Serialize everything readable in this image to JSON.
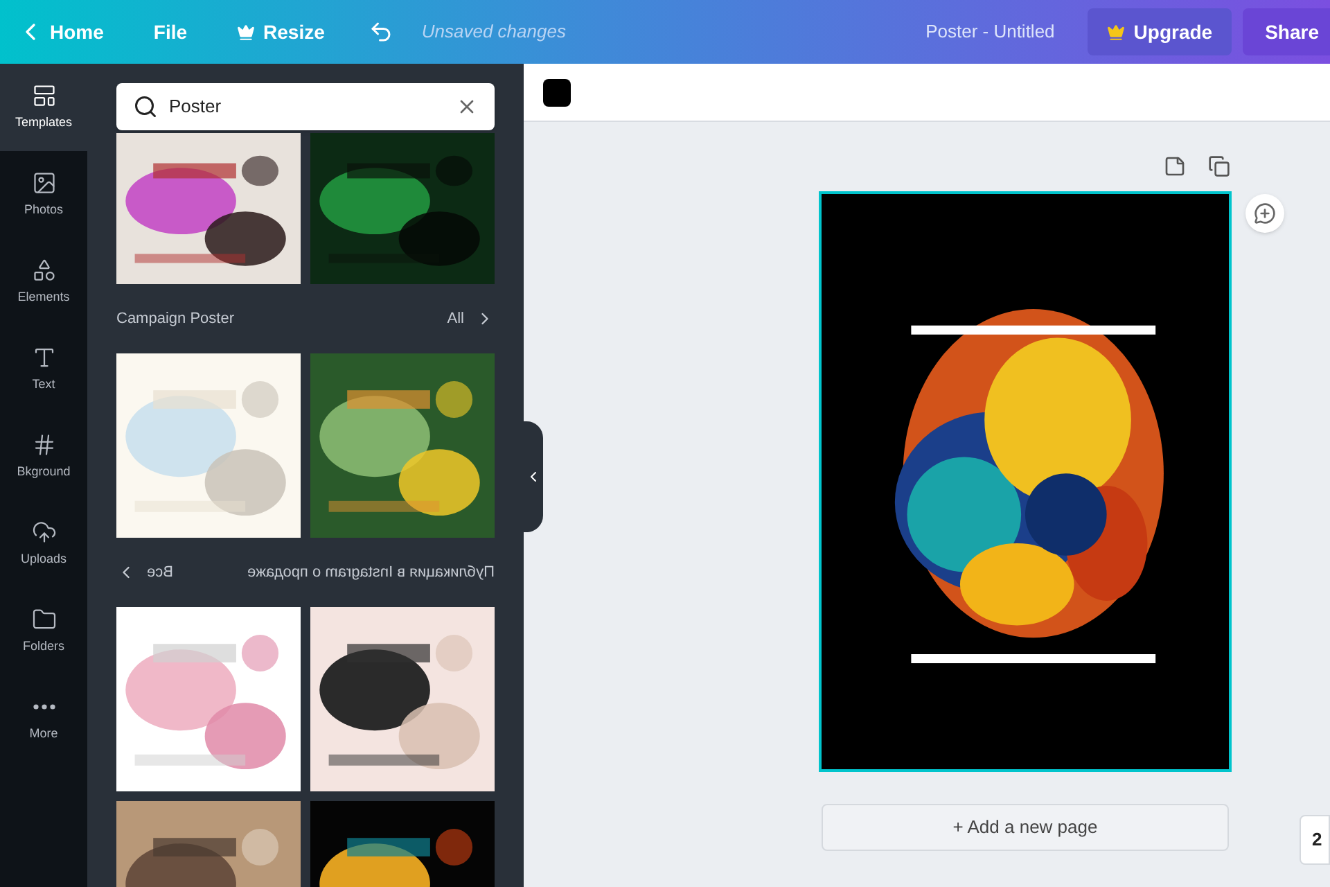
{
  "topbar": {
    "back": "Home",
    "menu": [
      "File",
      "Resize"
    ],
    "status": "Unsaved changes",
    "title": "Poster - Untitled",
    "upgrade": "Upgrade",
    "share": "Share"
  },
  "rail": [
    {
      "label": "Templates",
      "kind": "templates",
      "selected": true
    },
    {
      "label": "Photos",
      "kind": "photos",
      "selected": false
    },
    {
      "label": "Elements",
      "kind": "elements",
      "selected": false
    },
    {
      "label": "Text",
      "kind": "text",
      "selected": false
    },
    {
      "label": "Bkground",
      "kind": "background",
      "selected": false
    },
    {
      "label": "Uploads",
      "kind": "uploads",
      "selected": false
    },
    {
      "label": "Folders",
      "kind": "folders",
      "selected": false
    },
    {
      "label": "More",
      "kind": "more",
      "selected": false
    }
  ],
  "search": {
    "value": "Poster"
  },
  "sections": [
    {
      "thumbs": [
        {
          "kind": "picture"
        },
        {
          "kind": "picture"
        }
      ]
    },
    {
      "title": "Campaign Poster",
      "link": "All",
      "mirrored": false,
      "thumbs": [
        {
          "kind": "picture"
        },
        {
          "kind": "picture"
        }
      ]
    },
    {
      "title": "Публикация в Instagram о продаже",
      "link": "Все",
      "mirrored": true,
      "thumbs": [
        {
          "kind": "picture"
        },
        {
          "kind": "picture"
        }
      ]
    },
    {
      "thumbs": [
        {
          "kind": "picture"
        },
        {
          "kind": "picture"
        }
      ]
    }
  ],
  "toolbar": {
    "color": "#000000"
  },
  "canvas": {
    "selected": true,
    "add_page": "+ Add a new page",
    "zoom": "2"
  }
}
